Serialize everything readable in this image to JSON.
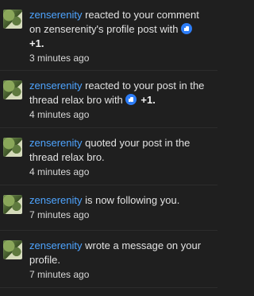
{
  "notifications": [
    {
      "user": "zenserenity",
      "parts": [
        " reacted to your comment on zenserenity's profile post with "
      ],
      "reaction": "+1.",
      "time": "3 minutes ago"
    },
    {
      "user": "zenserenity",
      "parts": [
        " reacted to your post in the thread relax bro with "
      ],
      "reaction": "+1.",
      "time": "4 minutes ago"
    },
    {
      "user": "zenserenity",
      "parts": [
        " quoted your post in the thread relax bro."
      ],
      "time": "4 minutes ago"
    },
    {
      "user": "zenserenity",
      "parts": [
        " is now following you."
      ],
      "time": "7 minutes ago"
    },
    {
      "user": "zenserenity",
      "parts": [
        " wrote a message on your profile."
      ],
      "time": "7 minutes ago"
    }
  ]
}
